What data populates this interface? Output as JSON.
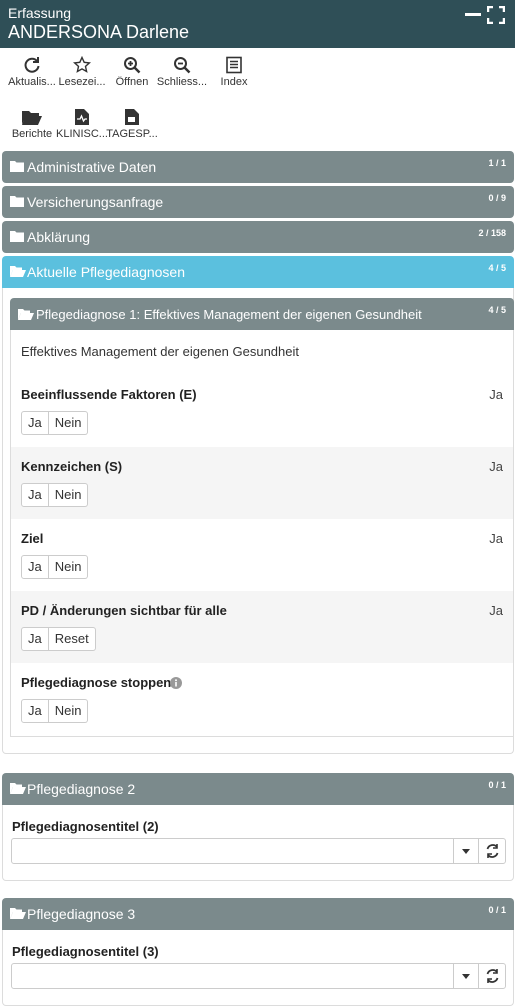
{
  "header": {
    "subtitle": "Erfassung",
    "title": "ANDERSONA Darlene"
  },
  "toolbar1": [
    {
      "label": "Aktualis...",
      "icon": "refresh-icon"
    },
    {
      "label": "Lesezei...",
      "icon": "star-icon"
    },
    {
      "label": "Öffnen",
      "icon": "zoom-in-icon"
    },
    {
      "label": "Schliess...",
      "icon": "zoom-out-icon"
    },
    {
      "label": "Index",
      "icon": "list-icon"
    }
  ],
  "toolbar2": [
    {
      "label": "Berichte",
      "icon": "folder-open-icon"
    },
    {
      "label": "KLINISC...",
      "icon": "file-chart-icon"
    },
    {
      "label": "TAGESP...",
      "icon": "file-icon"
    }
  ],
  "sections": [
    {
      "label": "Administrative Daten",
      "count": "1 / 1"
    },
    {
      "label": "Versicherungsanfrage",
      "count": "0 / 9"
    },
    {
      "label": "Abklärung",
      "count": "2 / 158"
    },
    {
      "label": "Aktuelle Pflegediagnosen",
      "count": "4 / 5"
    }
  ],
  "diagnosis1": {
    "label": "Pflegediagnose 1: Effektives Management der eigenen Gesundheit",
    "count": "4 / 5",
    "description": "Effektives Management der eigenen Gesundheit",
    "questions": [
      {
        "label": "Beeinflussende Faktoren (E)",
        "value": "Ja",
        "options": [
          "Ja",
          "Nein"
        ]
      },
      {
        "label": "Kennzeichen (S)",
        "value": "Ja",
        "options": [
          "Ja",
          "Nein"
        ]
      },
      {
        "label": "Ziel",
        "value": "Ja",
        "options": [
          "Ja",
          "Nein"
        ]
      },
      {
        "label": "PD / Änderungen sichtbar für alle",
        "value": "Ja",
        "options": [
          "Ja",
          "Reset"
        ]
      },
      {
        "label": "Pflegediagnose stoppen",
        "value": "",
        "options": [
          "Ja",
          "Nein"
        ]
      }
    ]
  },
  "diagnosis2": {
    "label": "Pflegediagnose 2",
    "count": "0 / 1",
    "field_label": "Pflegediagnosentitel (2)",
    "value": ""
  },
  "diagnosis3": {
    "label": "Pflegediagnose 3",
    "count": "0 / 1",
    "field_label": "Pflegediagnosentitel (3)",
    "value": ""
  },
  "colors": {
    "header": "#2f4f57",
    "section": "#7b8a8c",
    "active": "#5bc0de"
  }
}
